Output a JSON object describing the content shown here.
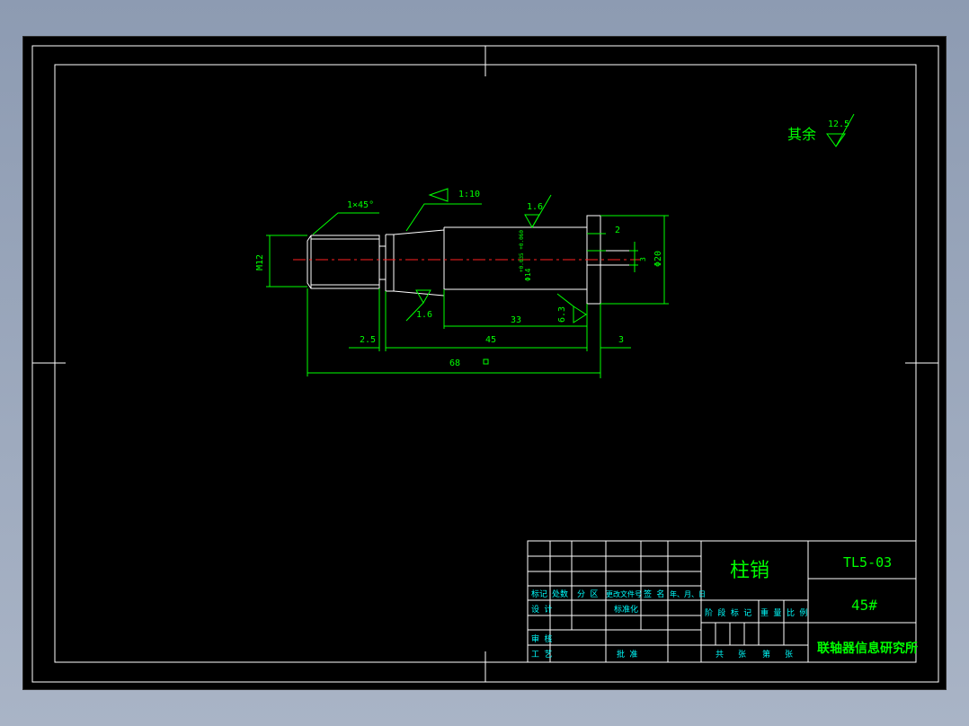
{
  "colors": {
    "background": "#000000",
    "outline": "#ffffff",
    "dimension": "#00ff00",
    "centerline": "#ff0000",
    "title_text": "#00ffff"
  },
  "annotations": {
    "rest_roughness_label": "其余",
    "rest_roughness_value": "12.5",
    "chamfer": "1×45°",
    "taper": "1:10",
    "roughness_a": "1.6",
    "roughness_b": "1.6",
    "roughness_c": "6.3",
    "thread": "M12",
    "bore_dia": "Φ14",
    "bore_tol": "+0.035 +0.060",
    "dia_20": "Φ20",
    "dim_2": "2",
    "dim_3_small": "3",
    "dim_33": "33",
    "dim_2_5": "2.5",
    "dim_45": "45",
    "dim_3": "3",
    "dim_68": "68"
  },
  "title_block": {
    "part_name": "柱销",
    "drawing_no": "TL5-03",
    "material": "45#",
    "institute": "联轴器信息研究所",
    "headers": {
      "mark": "标记",
      "count": "处数",
      "zone": "分 区",
      "change_doc": "更改文件号",
      "signature": "签 名",
      "date": "年、月、日"
    },
    "roles": {
      "design": "设 计",
      "standardize": "标准化",
      "review": "审 核",
      "process": "工 艺",
      "approve": "批 准"
    },
    "stage_row": {
      "stage_mark": "阶 段 标 记",
      "weight": "重 量",
      "scale": "比 例"
    },
    "sheet_row": {
      "total": "共",
      "sheets1": "张",
      "sheet_no": "第",
      "sheets2": "张"
    }
  }
}
